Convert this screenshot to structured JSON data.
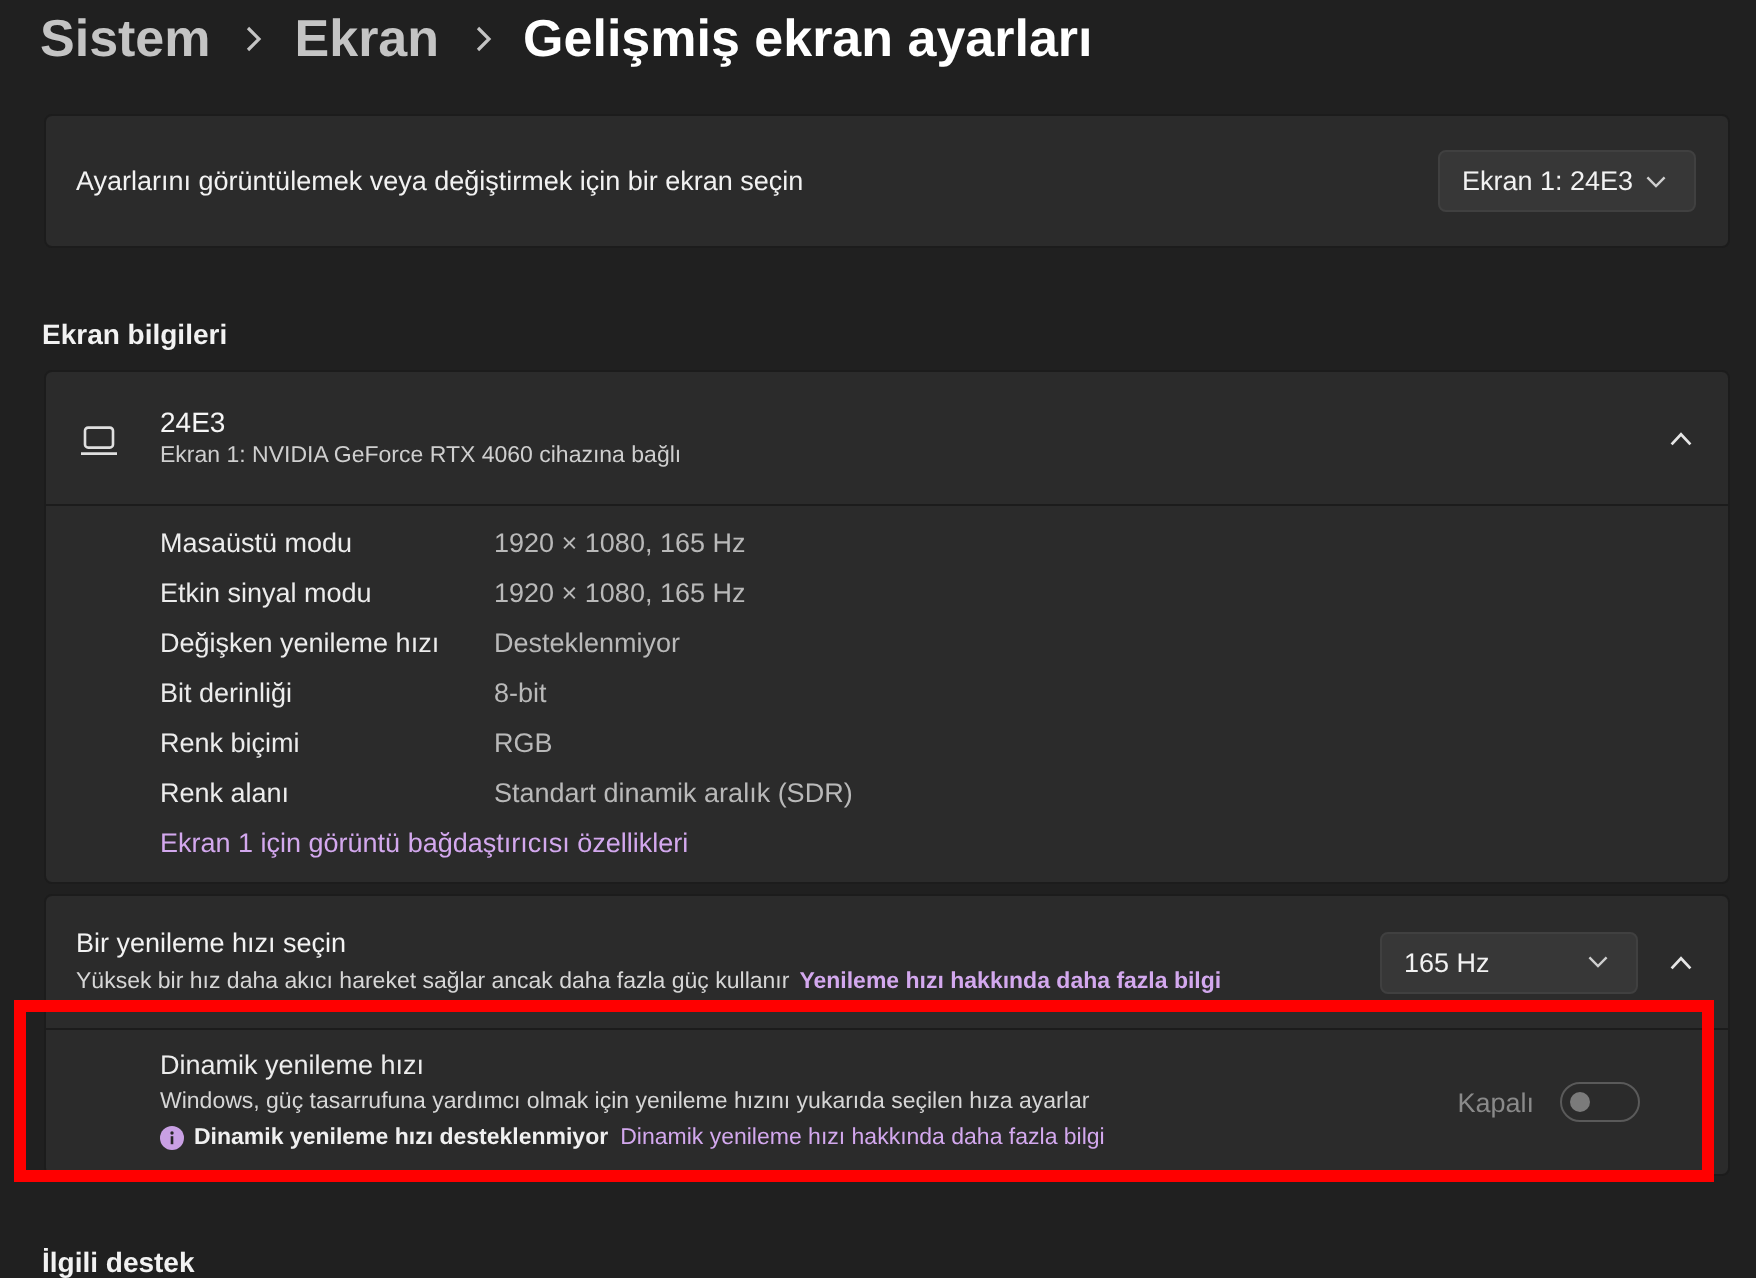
{
  "breadcrumb": [
    {
      "label": "Sistem",
      "current": false
    },
    {
      "label": "Ekran",
      "current": false
    },
    {
      "label": "Gelişmiş ekran ayarları",
      "current": true
    }
  ],
  "display_select": {
    "label": "Ayarlarını görüntülemek veya değiştirmek için bir ekran seçin",
    "value": "Ekran 1: 24E3"
  },
  "display_info": {
    "heading": "Ekran bilgileri",
    "title": "24E3",
    "subtitle": "Ekran 1: NVIDIA GeForce RTX 4060 cihazına bağlı",
    "expanded": true,
    "rows": [
      {
        "label": "Masaüstü modu",
        "value": "1920 × 1080, 165 Hz"
      },
      {
        "label": "Etkin sinyal modu",
        "value": "1920 × 1080, 165 Hz"
      },
      {
        "label": "Değişken yenileme hızı",
        "value": "Desteklenmiyor"
      },
      {
        "label": "Bit derinliği",
        "value": "8-bit"
      },
      {
        "label": "Renk biçimi",
        "value": "RGB"
      },
      {
        "label": "Renk alanı",
        "value": "Standart dinamik aralık (SDR)"
      }
    ],
    "link": "Ekran 1 için görüntü bağdaştırıcısı özellikleri"
  },
  "refresh_rate": {
    "title": "Bir yenileme hızı seçin",
    "description": "Yüksek bir hız daha akıcı hareket sağlar ancak daha fazla güç kullanır",
    "link": "Yenileme hızı hakkında daha fazla bilgi",
    "value": "165 Hz",
    "expanded": true,
    "dynamic": {
      "title": "Dinamik yenileme hızı",
      "description": "Windows, güç tasarrufuna yardımcı olmak için yenileme hızını yukarıda seçilen hıza ayarlar",
      "notice": "Dinamik yenileme hızı desteklenmiyor",
      "link": "Dinamik yenileme hızı hakkında daha fazla bilgi",
      "state_label": "Kapalı",
      "on": false,
      "disabled": true,
      "highlighted": true
    }
  },
  "related_heading": "İlgili destek"
}
